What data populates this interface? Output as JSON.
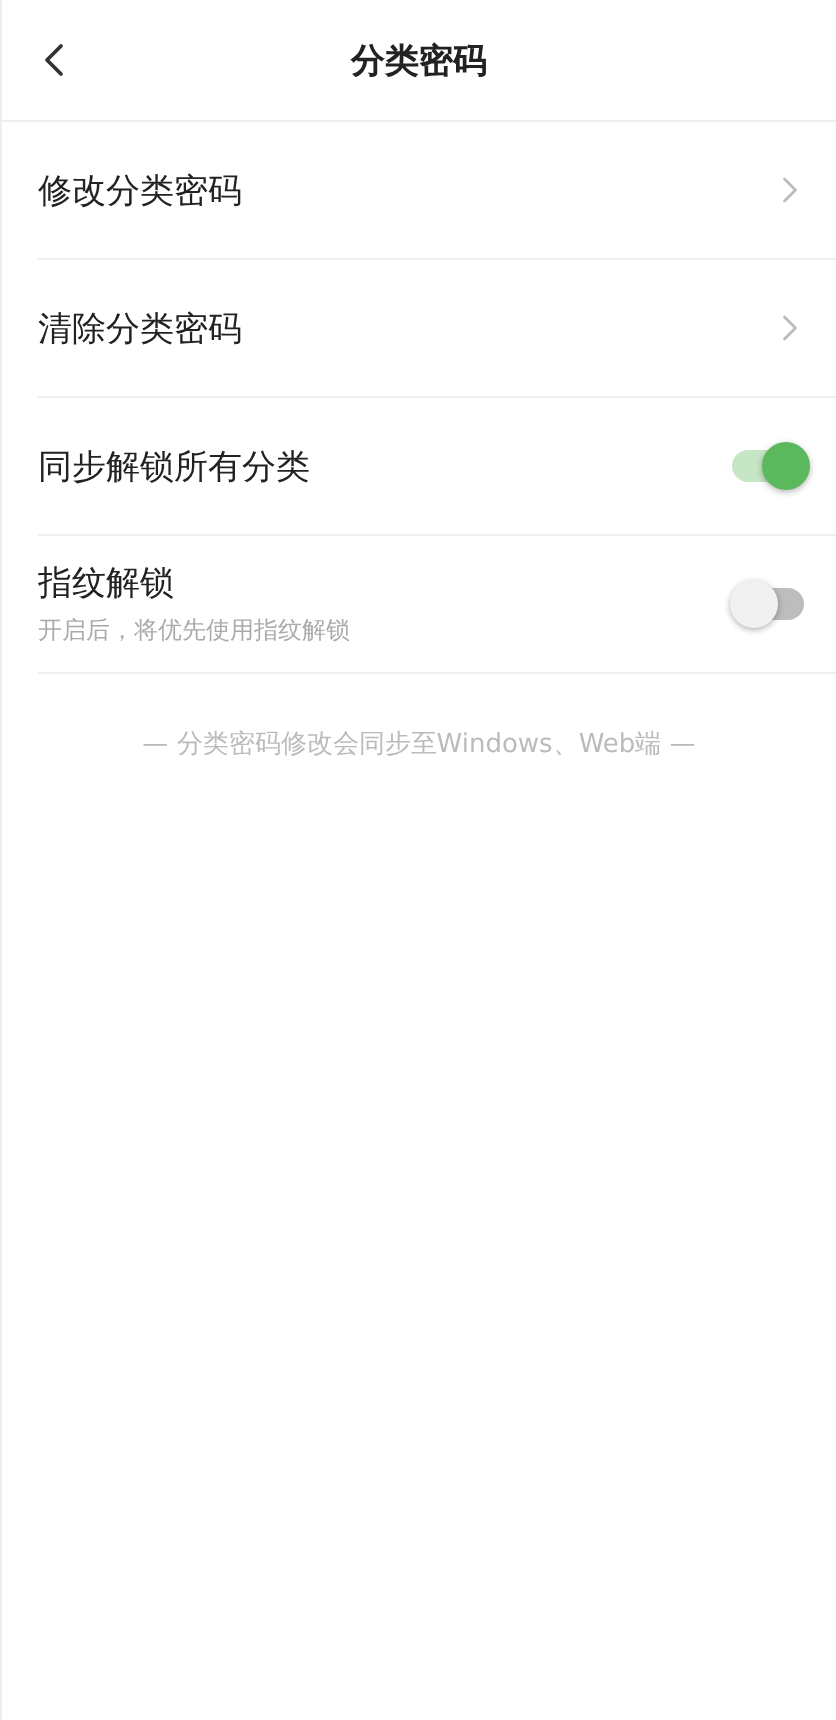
{
  "header": {
    "title": "分类密码"
  },
  "settings": [
    {
      "kind": "link",
      "label": "修改分类密码"
    },
    {
      "kind": "link",
      "label": "清除分类密码"
    },
    {
      "kind": "toggle",
      "label": "同步解锁所有分类",
      "on": true
    },
    {
      "kind": "toggle",
      "label": "指纹解锁",
      "description": "开启后，将优先使用指纹解锁",
      "on": false
    }
  ],
  "footer_note": "— 分类密码修改会同步至Windows、Web端 —"
}
